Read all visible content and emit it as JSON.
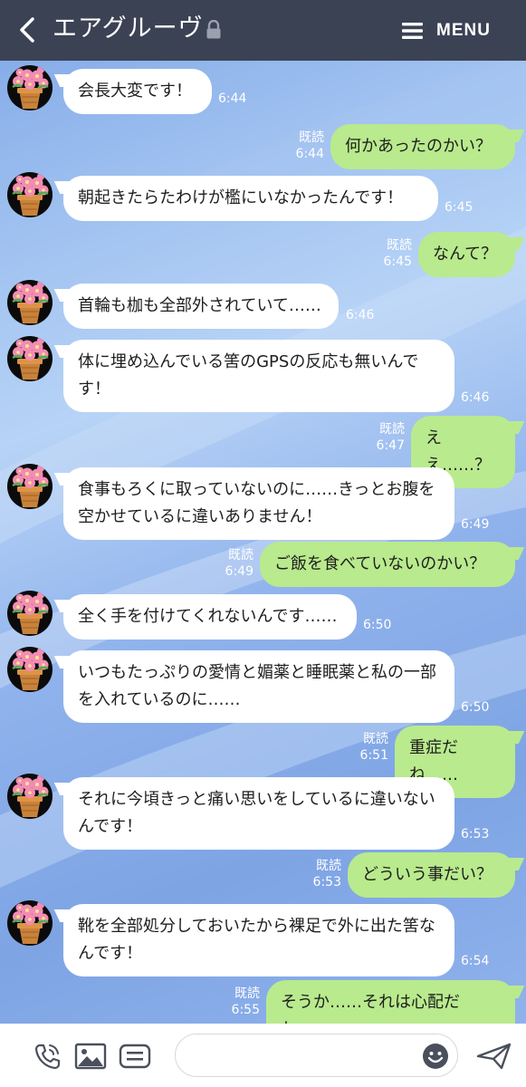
{
  "header": {
    "title": "エアグルーヴ",
    "menu_label": "MENU",
    "back_icon": "chevron-left-icon",
    "lock_icon": "lock-icon",
    "menu_icon": "hamburger-icon",
    "background_color": "#3b4254"
  },
  "messages": [
    {
      "side": "in",
      "text": "会長大変です！",
      "time": "6:44"
    },
    {
      "side": "out",
      "text": "何かあったのかい？",
      "read": "既読",
      "time": "6:44"
    },
    {
      "side": "in",
      "text": "朝起きたらたわけが檻にいなかったんです！",
      "time": "6:45"
    },
    {
      "side": "out",
      "text": "なんて？",
      "read": "既読",
      "time": "6:45"
    },
    {
      "side": "in",
      "text": "首輪も枷も全部外されていて……",
      "time": "6:46"
    },
    {
      "side": "in",
      "text": "体に埋め込んでいる筈のGPSの反応も無いんです！",
      "time": "6:46"
    },
    {
      "side": "out",
      "text": "ええ……？",
      "read": "既読",
      "time": "6:47"
    },
    {
      "side": "in",
      "text": "食事もろくに取っていないのに……きっとお腹を空かせているに違いありません！",
      "time": "6:49"
    },
    {
      "side": "out",
      "text": "ご飯を食べていないのかい？",
      "read": "既読",
      "time": "6:49"
    },
    {
      "side": "in",
      "text": "全く手を付けてくれないんです……",
      "time": "6:50"
    },
    {
      "side": "in",
      "text": "いつもたっぷりの愛情と媚薬と睡眠薬と私の一部を入れているのに……",
      "time": "6:50"
    },
    {
      "side": "out",
      "text": "重症だね……",
      "read": "既読",
      "time": "6:51"
    },
    {
      "side": "in",
      "text": "それに今頃きっと痛い思いをしているに違いないんです！",
      "time": "6:53"
    },
    {
      "side": "out",
      "text": "どういう事だい？",
      "read": "既読",
      "time": "6:53"
    },
    {
      "side": "in",
      "text": "靴を全部処分しておいたから裸足で外に出た筈なんです！",
      "time": "6:54"
    },
    {
      "side": "out",
      "text": "そうか……それは心配だね……",
      "read": "既読",
      "time": "6:55"
    }
  ],
  "avatar_icon": "flower-pot-icon",
  "footer": {
    "icons": [
      "phone-icon",
      "image-icon",
      "keyboard-menu-icon",
      "emoji-icon",
      "send-icon"
    ],
    "message_input_placeholder": ""
  },
  "colors": {
    "incoming_bubble": "#ffffff",
    "outgoing_bubble": "#b9ea8d"
  }
}
